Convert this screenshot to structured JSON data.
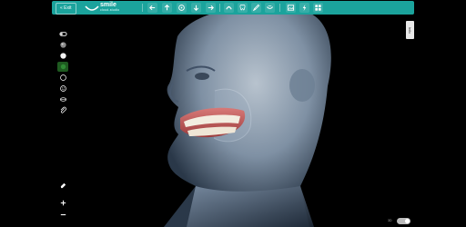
{
  "toolbar": {
    "exit_label": "« Exit",
    "brand_word": "smile",
    "brand_sub": "cloud-studio"
  },
  "side_panel": {
    "tab_label": "Info"
  },
  "view_toggle": {
    "label": "3D"
  },
  "colors": {
    "accent": "#1ba39c",
    "background": "#000000"
  }
}
